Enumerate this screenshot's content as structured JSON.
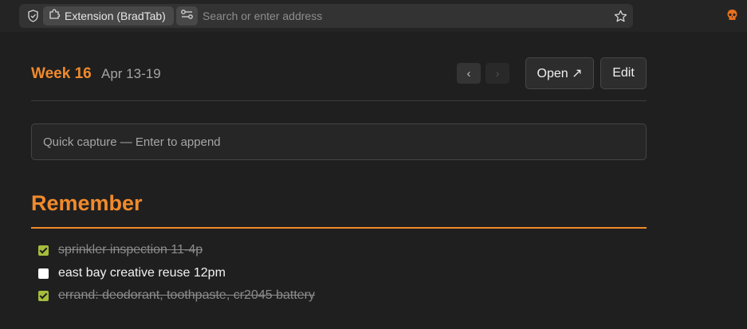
{
  "browser": {
    "extension_label": "Extension (BradTab)",
    "address_placeholder": "Search or enter address"
  },
  "header": {
    "week_label": "Week 16",
    "date_range": "Apr 13-19",
    "prev_label": "‹",
    "next_label": "›",
    "open_label": "Open ↗",
    "edit_label": "Edit"
  },
  "capture": {
    "placeholder": "Quick capture — Enter to append"
  },
  "section": {
    "title": "Remember",
    "tasks": [
      {
        "text": "sprinkler inspection 11-4p",
        "done": true
      },
      {
        "text": "east bay creative reuse 12pm",
        "done": false
      },
      {
        "text": "errand: deodorant, toothpaste, cr2045 battery",
        "done": true
      }
    ]
  },
  "colors": {
    "accent": "#f08a2c",
    "checkbox_checked": "#a6bd3c",
    "background": "#1f1f1f"
  },
  "icons": [
    "shield-icon",
    "puzzle-icon",
    "permissions-icon",
    "star-icon",
    "skull-icon"
  ]
}
